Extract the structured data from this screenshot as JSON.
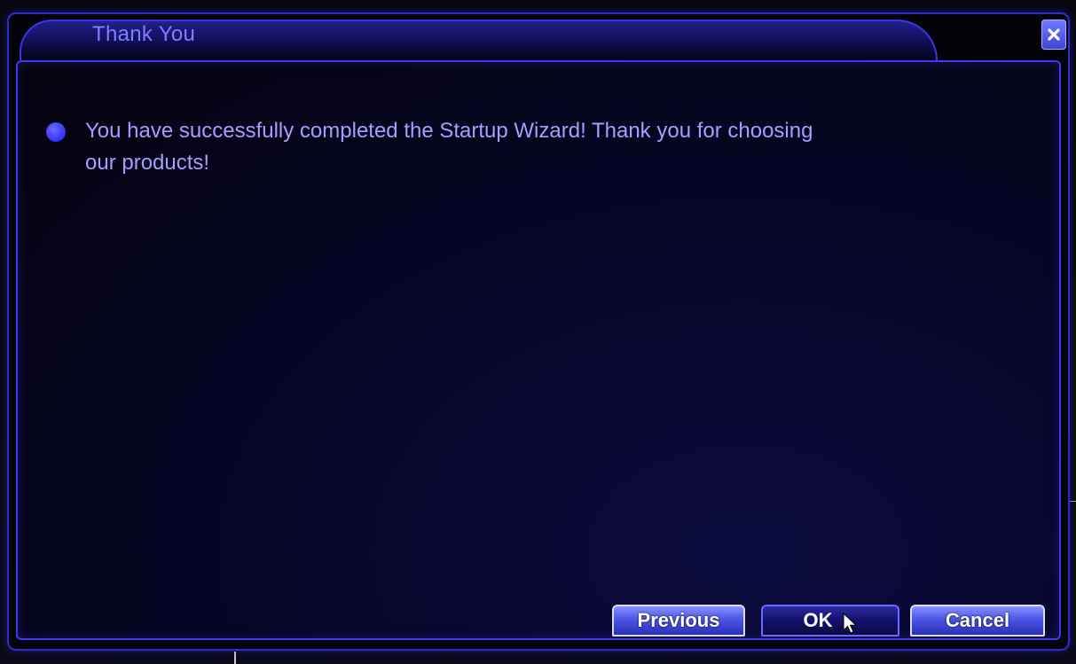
{
  "dialog": {
    "title": "Thank You",
    "close_icon": "close-icon"
  },
  "message": {
    "bullet_icon": "bullet-dot-icon",
    "text": "You have successfully completed the Startup Wizard! Thank you for choosing our products!"
  },
  "buttons": {
    "previous_label": "Previous",
    "ok_label": "OK",
    "cancel_label": "Cancel"
  },
  "pointer": {
    "icon": "mouse-pointer-icon"
  },
  "colors": {
    "accent_border": "#3d39f0",
    "title_text": "#7f7dff",
    "message_text": "#a99cff",
    "button_blue": "#4c55e6",
    "background": "#04040f"
  }
}
